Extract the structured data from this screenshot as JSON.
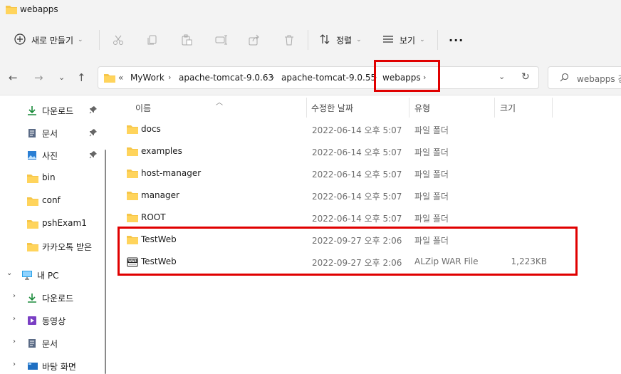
{
  "window": {
    "title": "webapps"
  },
  "toolbar": {
    "new_label": "새로 만들기",
    "sort_label": "정렬",
    "view_label": "보기",
    "more_label": "···"
  },
  "address": {
    "overflow": "«",
    "crumbs": [
      "MyWork",
      "apache-tomcat-9.0.63",
      "apache-tomcat-9.0.55",
      "webapps"
    ],
    "search_placeholder": "webapps 검"
  },
  "sidebar": {
    "quick": [
      {
        "label": "다운로드",
        "icon": "download-icon",
        "pinned": true
      },
      {
        "label": "문서",
        "icon": "document-icon",
        "pinned": true
      },
      {
        "label": "사진",
        "icon": "pictures-icon",
        "pinned": true
      },
      {
        "label": "bin",
        "icon": "folder-icon",
        "pinned": false
      },
      {
        "label": "conf",
        "icon": "folder-icon",
        "pinned": false
      },
      {
        "label": "pshExam1",
        "icon": "folder-icon",
        "pinned": false
      },
      {
        "label": "카카오톡 받은",
        "icon": "folder-icon",
        "pinned": false
      }
    ],
    "pc": {
      "label": "내 PC",
      "icon": "computer-icon"
    },
    "pc_items": [
      {
        "label": "다운로드",
        "icon": "download-icon"
      },
      {
        "label": "동영상",
        "icon": "video-icon"
      },
      {
        "label": "문서",
        "icon": "document-icon"
      },
      {
        "label": "바탕 화면",
        "icon": "desktop-icon"
      }
    ]
  },
  "list": {
    "columns": [
      "이름",
      "수정한 날짜",
      "유형",
      "크기"
    ],
    "rows": [
      {
        "name": "docs",
        "date": "2022-06-14 오후 5:07",
        "type": "파일 폴더",
        "size": "",
        "icon": "folder-icon"
      },
      {
        "name": "examples",
        "date": "2022-06-14 오후 5:07",
        "type": "파일 폴더",
        "size": "",
        "icon": "folder-icon"
      },
      {
        "name": "host-manager",
        "date": "2022-06-14 오후 5:07",
        "type": "파일 폴더",
        "size": "",
        "icon": "folder-icon"
      },
      {
        "name": "manager",
        "date": "2022-06-14 오후 5:07",
        "type": "파일 폴더",
        "size": "",
        "icon": "folder-icon"
      },
      {
        "name": "ROOT",
        "date": "2022-06-14 오후 5:07",
        "type": "파일 폴더",
        "size": "",
        "icon": "folder-icon"
      },
      {
        "name": "TestWeb",
        "date": "2022-09-27 오후 2:06",
        "type": "파일 폴더",
        "size": "",
        "icon": "folder-icon"
      },
      {
        "name": "TestWeb",
        "date": "2022-09-27 오후 2:06",
        "type": "ALZip WAR File",
        "size": "1,223KB",
        "icon": "war-archive-icon"
      }
    ]
  },
  "colors": {
    "folder": "#f6c64a",
    "highlight": "#e00000",
    "accent": "#0a7ad8"
  }
}
